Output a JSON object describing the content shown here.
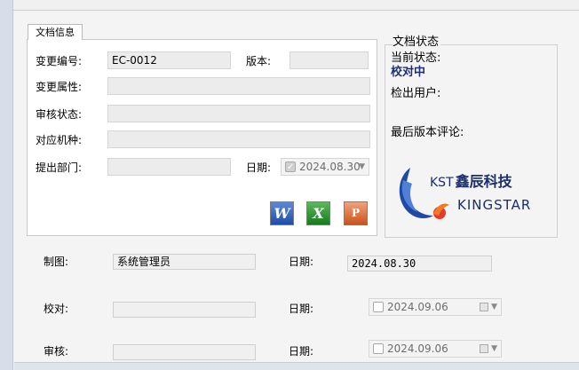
{
  "tab": {
    "label": "文档信息"
  },
  "doc": {
    "change_no_label": "变更编号:",
    "change_no_value": "EC-0012",
    "version_label": "版本:",
    "version_value": "",
    "change_attr_label": "变更属性:",
    "change_attr_value": "",
    "review_state_label": "审核状态:",
    "review_state_value": "",
    "model_label": "对应机种:",
    "model_value": "",
    "dept_label": "提出部门:",
    "dept_value": "",
    "date_label": "日期:",
    "date_value": "2024.08.30"
  },
  "icons": {
    "word": "W",
    "excel": "X",
    "ppt": "P"
  },
  "status": {
    "title": "文档状态",
    "current_label": "当前状态:",
    "current_value": "校对中",
    "checkout_label": "检出用户:",
    "comment_label": "最后版本评论:"
  },
  "logo": {
    "kst": "KST",
    "cn": "鑫辰科技",
    "en": "KINGSTAR"
  },
  "lower": {
    "drafter_label": "制图:",
    "drafter_value": "系统管理员",
    "drafter_date_label": "日期:",
    "drafter_date_value": "2024.08.30",
    "checker_label": "校对:",
    "checker_value": "",
    "checker_date_label": "日期:",
    "checker_date_value": "2024.09.06",
    "reviewer_label": "审核:",
    "reviewer_value": "",
    "reviewer_date_label": "日期:",
    "reviewer_date_value": "2024.09.06"
  }
}
